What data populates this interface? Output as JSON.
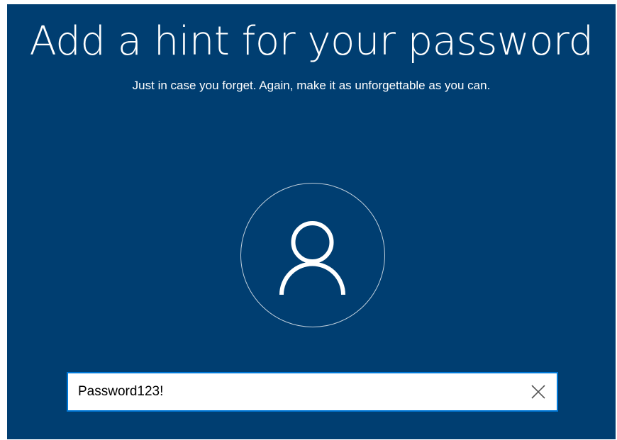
{
  "page": {
    "title": "Add a hint for your password",
    "subtitle": "Just in case you forget. Again, make it as unforgettable as you can."
  },
  "avatar": {
    "icon": "user-icon"
  },
  "hint_input": {
    "value": "Password123!",
    "clear_icon": "close-icon"
  },
  "colors": {
    "background": "#003e71",
    "input_border": "#0078d7",
    "text": "#ffffff"
  }
}
